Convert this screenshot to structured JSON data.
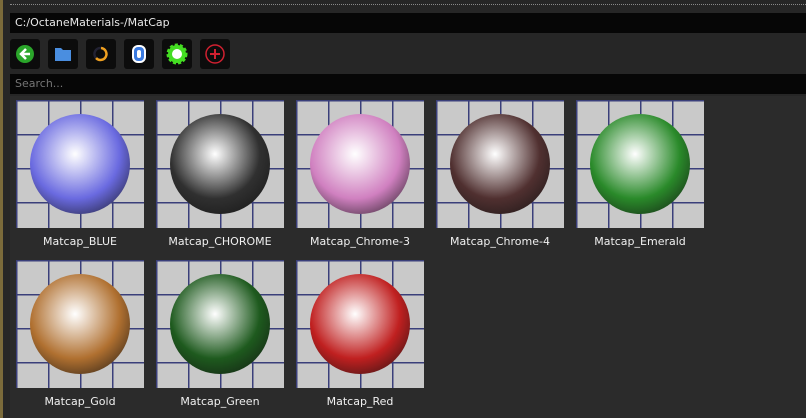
{
  "path": "C:/OctaneMaterials-/MatCap",
  "search_placeholder": "Search...",
  "toolbar": [
    {
      "name": "back-icon",
      "color": "#2aa52a"
    },
    {
      "name": "folder-icon",
      "color": "#4a8ee0"
    },
    {
      "name": "refresh-icon",
      "color": "#f0a020"
    },
    {
      "name": "zero-icon",
      "color": "#3a7ae0"
    },
    {
      "name": "sun-icon",
      "color": "#44dd22"
    },
    {
      "name": "add-icon",
      "color": "#d02030"
    }
  ],
  "materials": [
    {
      "label": "Matcap_BLUE",
      "color": "#6a6ae0"
    },
    {
      "label": "Matcap_CHOROME",
      "color": "#303030"
    },
    {
      "label": "Matcap_Chrome-3",
      "color": "#d080c0"
    },
    {
      "label": "Matcap_Chrome-4",
      "color": "#503030"
    },
    {
      "label": "Matcap_Emerald",
      "color": "#2a8a2a"
    },
    {
      "label": "Matcap_Gold",
      "color": "#b07030"
    },
    {
      "label": "Matcap_Green",
      "color": "#1e5a1e"
    },
    {
      "label": "Matcap_Red",
      "color": "#c02020"
    }
  ]
}
